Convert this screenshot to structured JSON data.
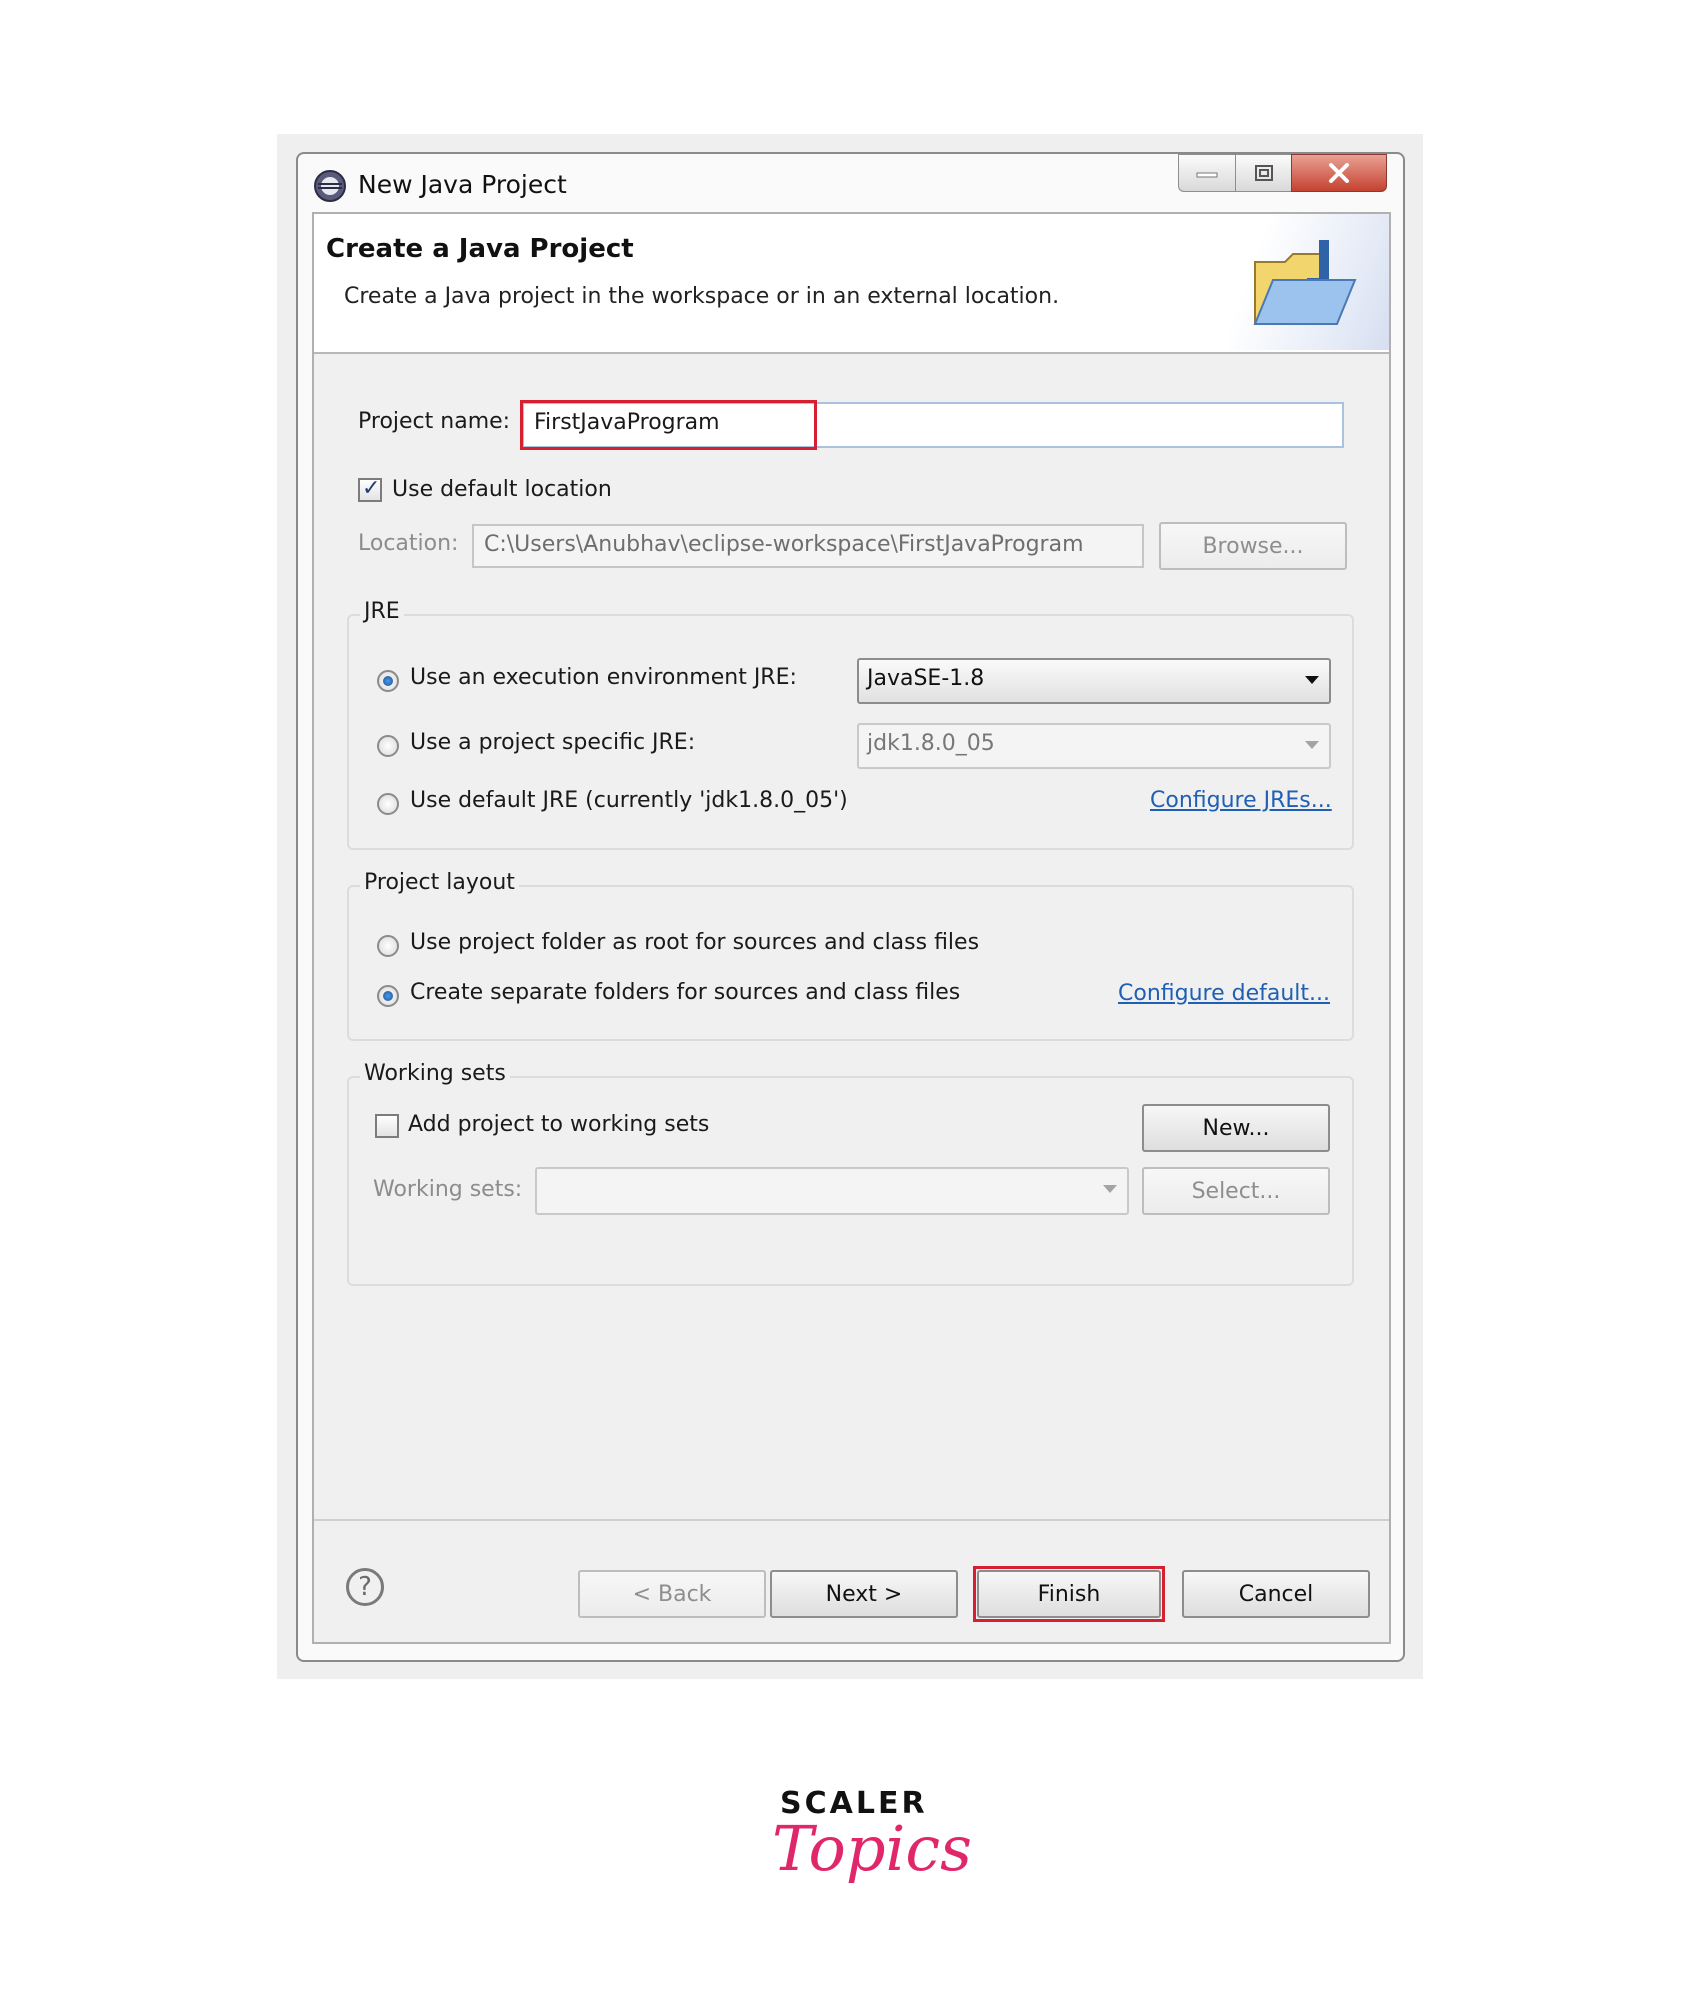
{
  "window": {
    "title": "New Java Project"
  },
  "banner": {
    "title": "Create a Java Project",
    "description": "Create a Java project in the workspace or in an external location."
  },
  "project": {
    "name_label": "Project name:",
    "name_value": "FirstJavaProgram"
  },
  "location": {
    "use_default_label": "Use default location",
    "use_default_checked": true,
    "label": "Location:",
    "value": "C:\\Users\\Anubhav\\eclipse-workspace\\FirstJavaProgram",
    "browse_label": "Browse..."
  },
  "jre": {
    "legend": "JRE",
    "option_env": "Use an execution environment JRE:",
    "env_value": "JavaSE-1.8",
    "option_specific": "Use a project specific JRE:",
    "specific_value": "jdk1.8.0_05",
    "option_default": "Use default JRE (currently 'jdk1.8.0_05')",
    "configure_link": "Configure JREs...",
    "selected": "env"
  },
  "layout": {
    "legend": "Project layout",
    "option_root": "Use project folder as root for sources and class files",
    "option_separate": "Create separate folders for sources and class files",
    "configure_link": "Configure default...",
    "selected": "separate"
  },
  "working_sets": {
    "legend": "Working sets",
    "add_label": "Add project to working sets",
    "add_checked": false,
    "new_label": "New...",
    "sets_label": "Working sets:",
    "sets_value": "",
    "select_label": "Select..."
  },
  "footer": {
    "help_glyph": "?",
    "back_label": "< Back",
    "next_label": "Next >",
    "finish_label": "Finish",
    "cancel_label": "Cancel"
  },
  "branding": {
    "line1": "SCALER",
    "line2": "Topics"
  },
  "colors": {
    "highlight": "#d6202f",
    "link": "#1f5fb4",
    "brand": "#e0276a"
  }
}
